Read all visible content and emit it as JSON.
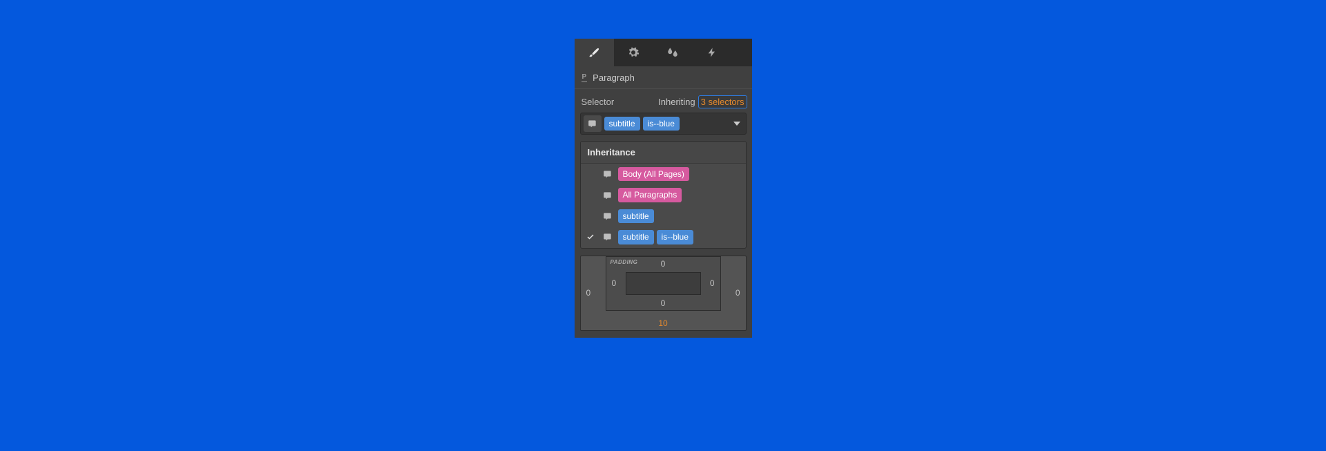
{
  "element": {
    "type_glyph": "P",
    "name": "Paragraph"
  },
  "selector": {
    "label": "Selector",
    "inheriting_label": "Inheriting",
    "inheriting_count": "3 selectors",
    "current_tags": [
      {
        "label": "subtitle",
        "kind": "class"
      },
      {
        "label": "is--blue",
        "kind": "class"
      }
    ]
  },
  "inheritance": {
    "header": "Inheritance",
    "items": [
      {
        "checked": false,
        "tags": [
          {
            "label": "Body (All Pages)",
            "kind": "tag"
          }
        ]
      },
      {
        "checked": false,
        "tags": [
          {
            "label": "All Paragraphs",
            "kind": "tag"
          }
        ]
      },
      {
        "checked": false,
        "tags": [
          {
            "label": "subtitle",
            "kind": "class"
          }
        ]
      },
      {
        "checked": true,
        "tags": [
          {
            "label": "subtitle",
            "kind": "class"
          },
          {
            "label": "is--blue",
            "kind": "class"
          }
        ]
      }
    ]
  },
  "boxmodel": {
    "padding_label": "PADDING",
    "margin": {
      "top": "",
      "right": "0",
      "bottom": "10",
      "left": "0"
    },
    "padding": {
      "top": "0",
      "right": "0",
      "bottom": "0",
      "left": "0"
    }
  }
}
